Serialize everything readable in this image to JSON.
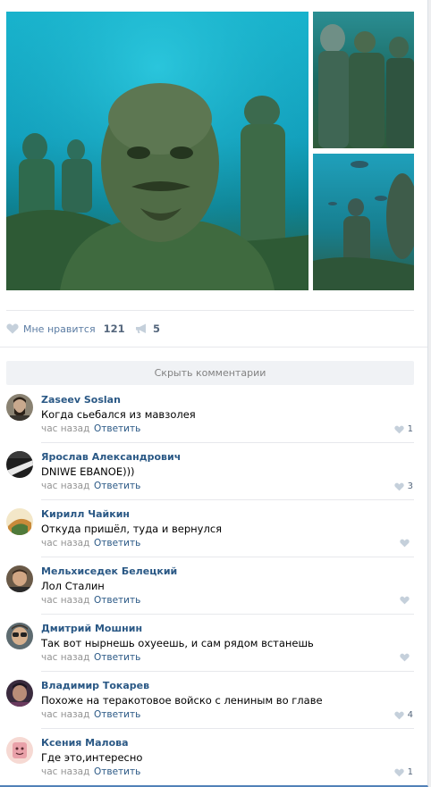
{
  "post": {
    "photos": [
      {
        "name": "main-photo"
      },
      {
        "name": "side-photo-top"
      },
      {
        "name": "side-photo-bottom"
      }
    ],
    "actions": {
      "like_label": "Мне нравится",
      "like_count": "121",
      "share_count": "5",
      "like_icon": "heart-icon",
      "share_icon": "megaphone-icon"
    },
    "hide_comments_label": "Скрыть комментарии",
    "colors": {
      "link": "#2a5885",
      "action": "#5b7ca3",
      "muted": "#939393",
      "button_bg": "#f0f2f5",
      "accent_border": "#5181b8"
    }
  },
  "comments": [
    {
      "author": "Zaseev Soslan",
      "text": "Когда сьебался из мавзолея",
      "time": "час назад",
      "reply": "Ответить",
      "likes": "1"
    },
    {
      "author": "Ярослав Александрович",
      "text": "DNIWE EBANOE)))",
      "time": "час назад",
      "reply": "Ответить",
      "likes": "3"
    },
    {
      "author": "Кирилл Чайкин",
      "text": "Откуда пришёл, туда и вернулся",
      "time": "час назад",
      "reply": "Ответить",
      "likes": ""
    },
    {
      "author": "Мельхиседек Белецкий",
      "text": "Лол Сталин",
      "time": "час назад",
      "reply": "Ответить",
      "likes": ""
    },
    {
      "author": "Дмитрий Мошнин",
      "text": "Так вот нырнешь охуеешь, и сам рядом встанешь",
      "time": "час назад",
      "reply": "Ответить",
      "likes": ""
    },
    {
      "author": "Владимир Токарев",
      "text": "Похоже на теракотовое войско с лениным во главе",
      "time": "час назад",
      "reply": "Ответить",
      "likes": "4"
    },
    {
      "author": "Ксения Малова",
      "text": "Где это,интересно",
      "time": "час назад",
      "reply": "Ответить",
      "likes": "1"
    }
  ]
}
